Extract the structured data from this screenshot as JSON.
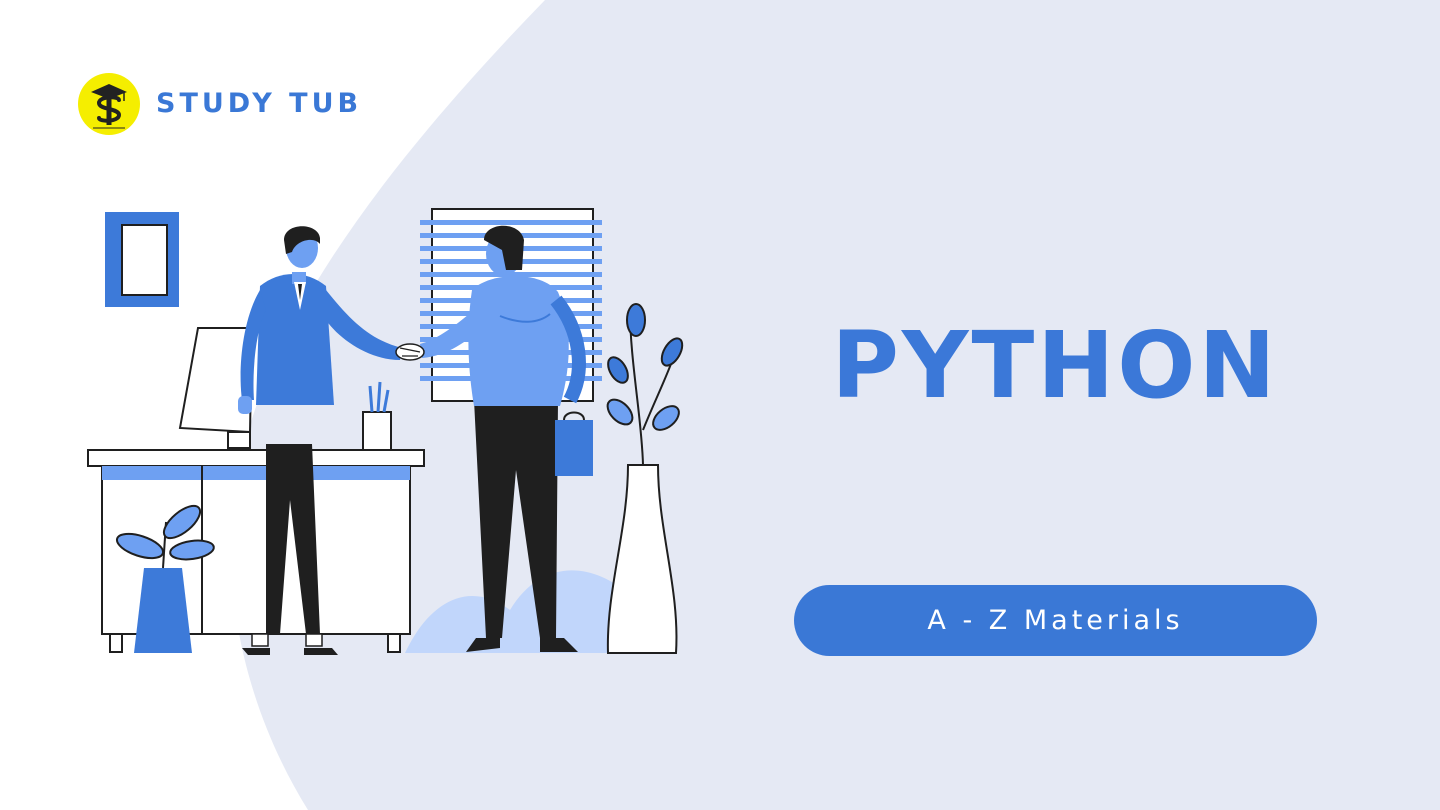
{
  "brand": {
    "name": "STUDY TUB",
    "logo_icon": "study-tub-logo-icon",
    "logo_color": "#f5ee00"
  },
  "hero": {
    "title": "PYTHON",
    "cta_label": "A - Z Materials"
  },
  "colors": {
    "accent": "#3a78d6",
    "background_shape": "#e5e9f4",
    "illustration_blue": "#3d7ad9",
    "illustration_light_blue": "#6ea0f2",
    "illustration_dark": "#1f1f1f"
  },
  "illustration": {
    "icon": "business-handshake-illustration"
  }
}
